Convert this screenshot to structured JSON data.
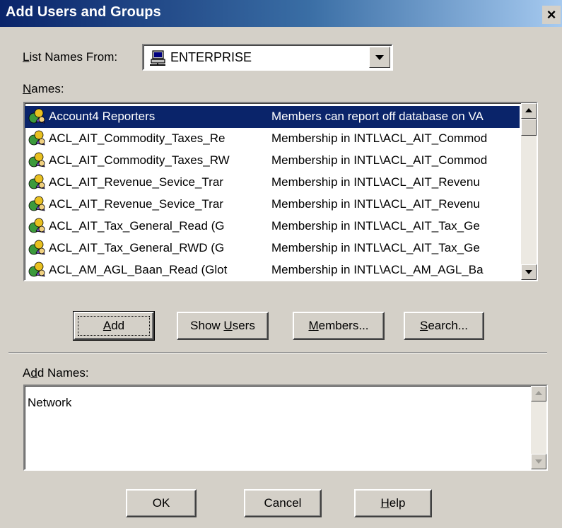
{
  "window": {
    "title": "Add Users and Groups",
    "close_label": "×"
  },
  "list_from": {
    "label_underline": "L",
    "label_rest": "ist Names From:",
    "value": "ENTERPRISE",
    "icon": "computer-network-icon"
  },
  "names": {
    "label_underline": "N",
    "label_rest": "ames:",
    "rows": [
      {
        "name": "Account4 Reporters",
        "description": "Members can report off database on VA",
        "selected": true
      },
      {
        "name": "ACL_AIT_Commodity_Taxes_Re",
        "description": "Membership in INTL\\ACL_AIT_Commod"
      },
      {
        "name": "ACL_AIT_Commodity_Taxes_RW",
        "description": "Membership in INTL\\ACL_AIT_Commod"
      },
      {
        "name": "ACL_AIT_Revenue_Sevice_Trar",
        "description": "Membership in INTL\\ACL_AIT_Revenu"
      },
      {
        "name": "ACL_AIT_Revenue_Sevice_Trar",
        "description": "Membership in INTL\\ACL_AIT_Revenu"
      },
      {
        "name": "ACL_AIT_Tax_General_Read (G",
        "description": "Membership in INTL\\ACL_AIT_Tax_Ge"
      },
      {
        "name": "ACL_AIT_Tax_General_RWD (G",
        "description": "Membership in INTL\\ACL_AIT_Tax_Ge"
      },
      {
        "name": "ACL_AM_AGL_Baan_Read (Glot",
        "description": "Membership in INTL\\ACL_AM_AGL_Ba"
      }
    ],
    "row_icon": "group-icon"
  },
  "buttons": {
    "add": {
      "u": "A",
      "rest": "dd"
    },
    "show_users": {
      "pre": "Show ",
      "u": "U",
      "rest": "sers"
    },
    "members": {
      "u": "M",
      "rest": "embers..."
    },
    "search": {
      "u": "S",
      "rest": "earch..."
    }
  },
  "add_names": {
    "label_pre": "A",
    "label_u": "d",
    "label_rest": "d Names:",
    "value": "Network"
  },
  "footer": {
    "ok": "OK",
    "cancel": "Cancel",
    "help": {
      "u": "H",
      "rest": "elp"
    }
  },
  "colors": {
    "selection": "#0a246a",
    "dialog": "#d4d0c8",
    "title_start": "#0a246a",
    "title_end": "#a6caf0"
  }
}
